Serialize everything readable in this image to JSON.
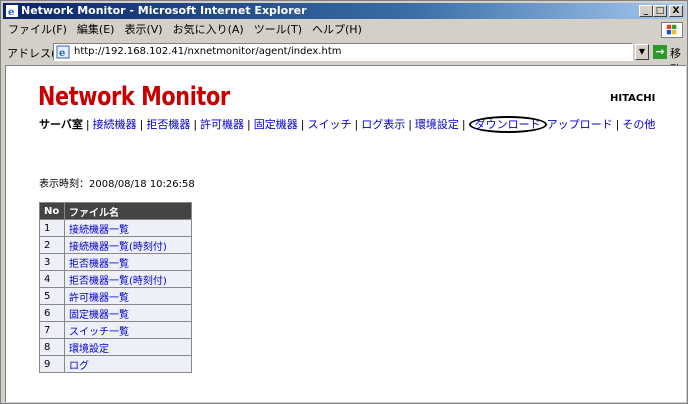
{
  "window": {
    "title": "Network Monitor - Microsoft Internet Explorer",
    "controls": {
      "minimize": "_",
      "maximize": "□",
      "close": "X"
    }
  },
  "menu": {
    "items": [
      "ファイル(F)",
      "編集(E)",
      "表示(V)",
      "お気に入り(A)",
      "ツール(T)",
      "ヘルプ(H)"
    ]
  },
  "address": {
    "label": "アドレス(D)",
    "url": "http://192.168.102.41/nxnetmonitor/agent/index.htm",
    "go_label": "移動"
  },
  "page": {
    "logo": "Network Monitor",
    "brand": "HITACHI",
    "nav": {
      "current": "サーバ室",
      "links": [
        "接続機器",
        "拒否機器",
        "許可機器",
        "固定機器",
        "スイッチ",
        "ログ表示",
        "環境設定",
        "ダウンロード",
        "アップロード",
        "その他"
      ],
      "separator": "|"
    },
    "timestamp": "表示時刻：2008/08/18 10:26:58",
    "table": {
      "headers": [
        "No",
        "ファイル名"
      ],
      "rows": [
        {
          "no": "1",
          "name": "接続機器一覧"
        },
        {
          "no": "2",
          "name": "接続機器一覧(時刻付)"
        },
        {
          "no": "3",
          "name": "拒否機器一覧"
        },
        {
          "no": "4",
          "name": "拒否機器一覧(時刻付)"
        },
        {
          "no": "5",
          "name": "許可機器一覧"
        },
        {
          "no": "6",
          "name": "固定機器一覧"
        },
        {
          "no": "7",
          "name": "スイッチ一覧"
        },
        {
          "no": "8",
          "name": "環境設定"
        },
        {
          "no": "9",
          "name": "ログ"
        }
      ]
    }
  },
  "icons": [
    "ie-icon",
    "windows-logo-icon",
    "page-icon",
    "go-arrow-icon"
  ]
}
